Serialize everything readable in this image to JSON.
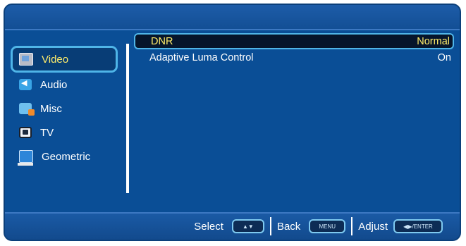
{
  "menu": [
    {
      "name": "video",
      "label": "Video",
      "icon": "video-icon",
      "active": true
    },
    {
      "name": "audio",
      "label": "Audio",
      "icon": "audio-icon",
      "active": false
    },
    {
      "name": "misc",
      "label": "Misc",
      "icon": "misc-icon",
      "active": false
    },
    {
      "name": "tv",
      "label": "TV",
      "icon": "tv-icon",
      "active": false
    },
    {
      "name": "geometric",
      "label": "Geometric",
      "icon": "geometric-icon",
      "active": false
    }
  ],
  "settings": [
    {
      "name": "DNR",
      "value": "Normal",
      "selected": true
    },
    {
      "name": "Adaptive Luma Control",
      "value": "On",
      "selected": false
    }
  ],
  "hints": {
    "select_label": "Select",
    "select_key": "▲▼",
    "back_label": "Back",
    "back_key": "MENU",
    "adjust_label": "Adjust",
    "adjust_key": "◀▶/ENTER"
  },
  "colors": {
    "panel_bg": "#0a4e96",
    "highlight_text": "#ffec6a",
    "accent_border": "#4fb5e8"
  }
}
